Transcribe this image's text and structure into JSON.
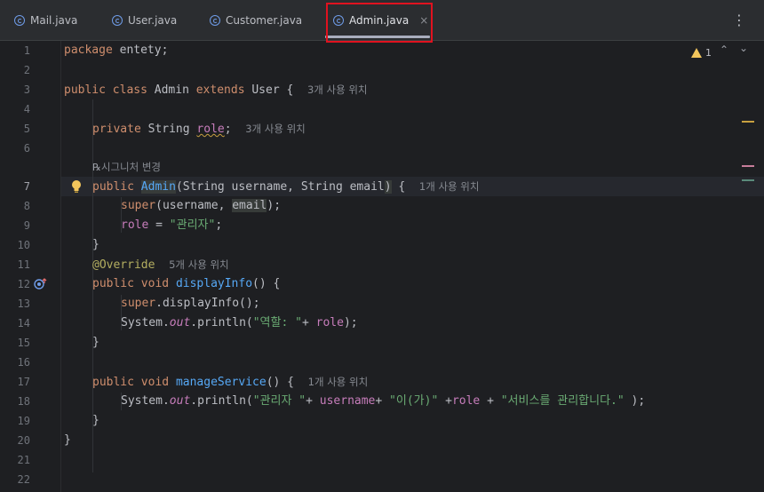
{
  "tabs": [
    {
      "label": "Mail.java",
      "icon": "mail-class-icon"
    },
    {
      "label": "User.java",
      "icon": "class-icon"
    },
    {
      "label": "Customer.java",
      "icon": "class-icon"
    },
    {
      "label": "Admin.java",
      "icon": "class-icon",
      "active": true,
      "close": "×"
    }
  ],
  "menu_glyph": "⋮",
  "inspection": {
    "warning_count": "1",
    "up": "⌃",
    "down": "⌄"
  },
  "line_numbers": [
    "1",
    "2",
    "3",
    "4",
    "5",
    "6",
    "7",
    "8",
    "9",
    "10",
    "11",
    "12",
    "13",
    "14",
    "15",
    "16",
    "17",
    "18",
    "19",
    "20",
    "21",
    "22"
  ],
  "code": {
    "l1_kw": "package",
    "l1_rest": " entety;",
    "l3_kw1": "public",
    "l3_kw2": "class",
    "l3_name": " Admin ",
    "l3_kw3": "extends",
    "l3_rest": " User {",
    "l3_hint": "3개 사용 위치",
    "l5_kw": "private",
    "l5_type": " String ",
    "l5_field": "role",
    "l5_end": ";",
    "l5_hint": "3개 사용 위치",
    "l6b_hint": "시그니처 변경",
    "l7_kw": "public",
    "l7_fn": "Admin",
    "l7_p1": "(String username, String ",
    "l7_p2": "email",
    "l7_p3": ")",
    "l7_end": " {",
    "l7_hint": "1개 사용 위치",
    "l8_kw": "super",
    "l8_a": "(username, ",
    "l8_sel": "email",
    "l8_end": ");",
    "l9_field": "role",
    "l9_eq": " = ",
    "l9_str": "\"관리자\"",
    "l9_end": ";",
    "l10": "}",
    "l11_ann": "@Override",
    "l11_hint": "5개 사용 위치",
    "l12_kw1": "public",
    "l12_kw2": "void",
    "l12_fn": "displayInfo",
    "l12_end": "() {",
    "l13_kw": "super",
    "l13_rest": ".displayInfo();",
    "l14_a": "System.",
    "l14_st": "out",
    "l14_b": ".println(",
    "l14_str": "\"역할: \"",
    "l14_c": "+ ",
    "l14_field": "role",
    "l14_end": ");",
    "l15": "}",
    "l17_kw": "public",
    "l17_kw2": "void",
    "l17_fn": "manageService",
    "l17_end": "() {",
    "l17_hint": "1개 사용 위치",
    "l18_a": "System.",
    "l18_st": "out",
    "l18_b": ".println(",
    "l18_s1": "\"관리자 \"",
    "l18_c": "+ ",
    "l18_f1": "username",
    "l18_d": "+ ",
    "l18_s2": "\"이(가)\"",
    "l18_e": " +",
    "l18_f2": "role",
    "l18_g": " + ",
    "l18_s3": "\"서비스를 관리합니다.\"",
    "l18_end": " );",
    "l19": "}",
    "l20": "}"
  },
  "colors": {
    "accent_highlight": "#e0121f",
    "warning": "#f2c55c"
  }
}
